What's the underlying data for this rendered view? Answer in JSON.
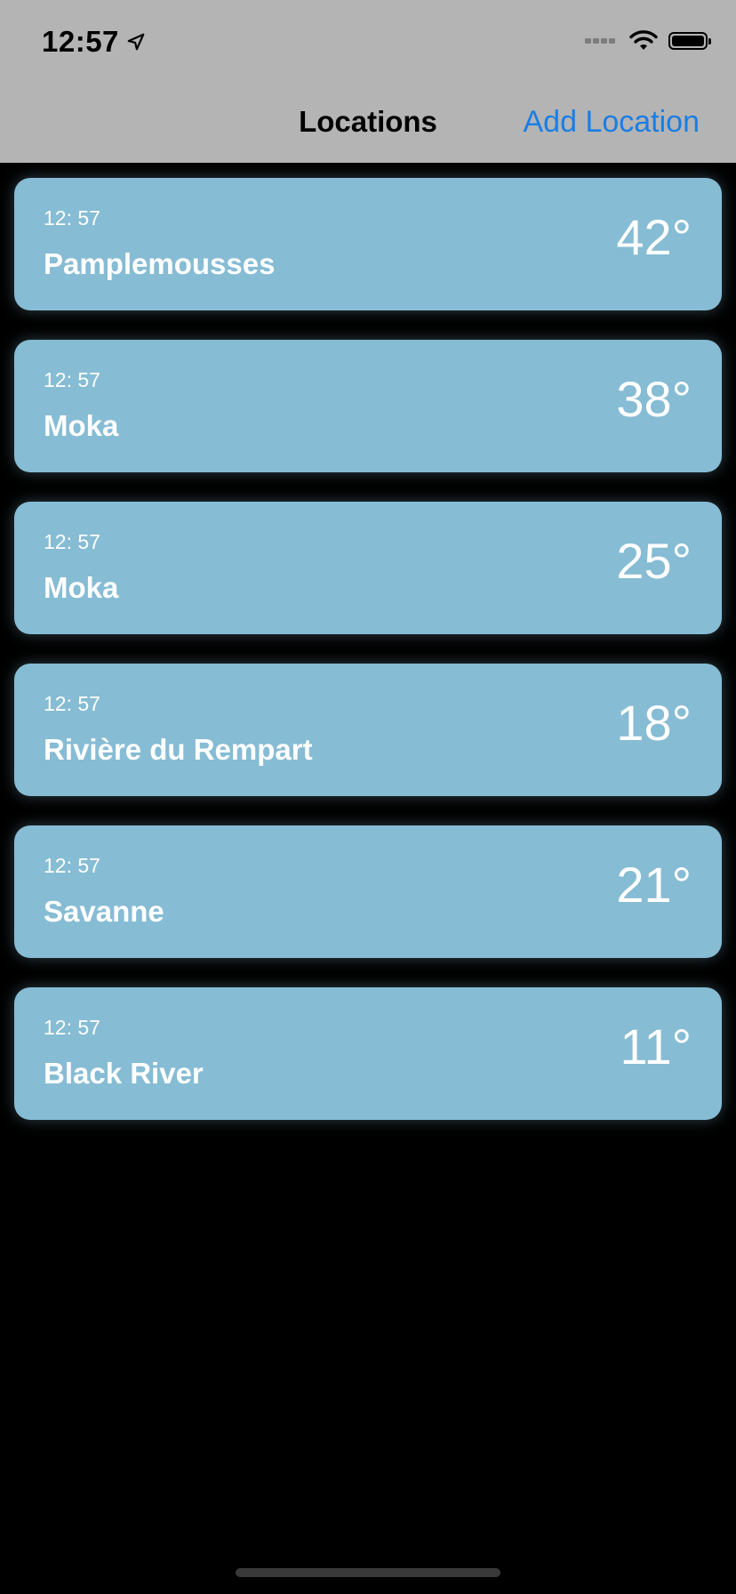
{
  "status_bar": {
    "time": "12:57",
    "location_icon": "location-arrow-icon",
    "signal_icon": "cellular-signal-icon",
    "wifi_icon": "wifi-icon",
    "battery_icon": "battery-icon"
  },
  "nav": {
    "title": "Locations",
    "add_label": "Add Location"
  },
  "colors": {
    "nav_background": "#b4b4b4",
    "accent": "#1a7ee6",
    "card_background": "#86bcd4",
    "screen_background": "#000000"
  },
  "locations": [
    {
      "time": "12: 57",
      "name": "Pamplemousses",
      "temp": "42°"
    },
    {
      "time": "12: 57",
      "name": "Moka",
      "temp": "38°"
    },
    {
      "time": "12: 57",
      "name": "Moka",
      "temp": "25°"
    },
    {
      "time": "12: 57",
      "name": "Rivière du Rempart",
      "temp": "18°"
    },
    {
      "time": "12: 57",
      "name": "Savanne",
      "temp": "21°"
    },
    {
      "time": "12: 57",
      "name": "Black River",
      "temp": "11°"
    }
  ]
}
